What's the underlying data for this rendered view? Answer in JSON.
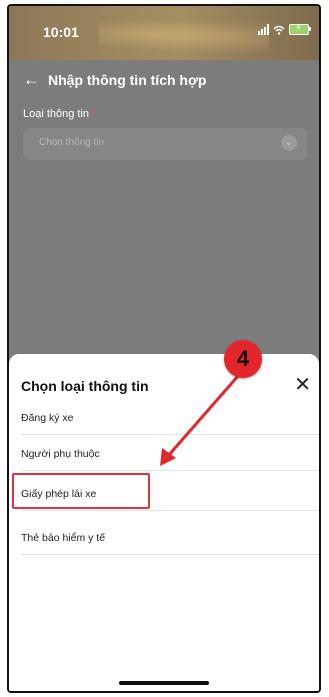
{
  "status_bar": {
    "time": "10:01"
  },
  "header": {
    "title": "Nhập thông tin tích hợp"
  },
  "form": {
    "field_label": "Loại thông tin",
    "required_mark": "*",
    "select_placeholder": "Chọn thông tin"
  },
  "sheet": {
    "title": "Chọn loại thông tin",
    "options": [
      {
        "label": "Đăng ký xe"
      },
      {
        "label": "Người phụ thuộc"
      },
      {
        "label": "Giấy phép lái xe"
      },
      {
        "label": "Thẻ bảo hiểm y tế"
      }
    ],
    "highlighted_index": 2
  },
  "annotation": {
    "step_number": "4",
    "color": "#e4262b"
  }
}
